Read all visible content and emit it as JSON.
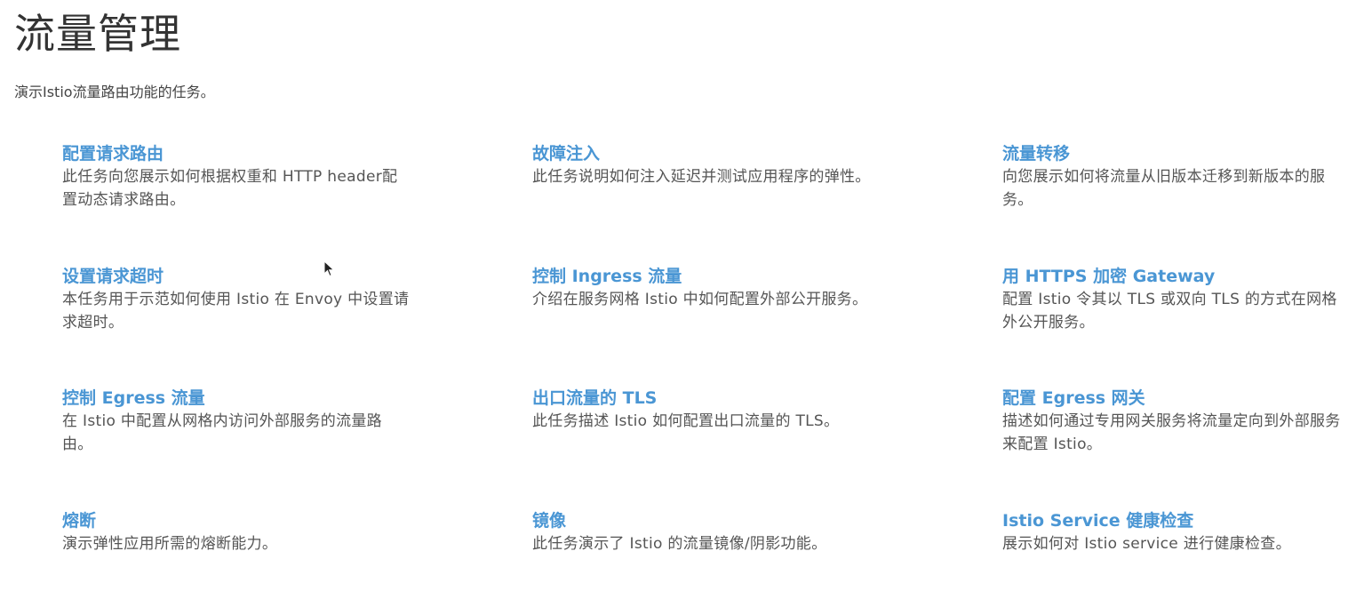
{
  "page": {
    "title": "流量管理",
    "subtitle": "演示Istio流量路由功能的任务。"
  },
  "colors": {
    "link": "#4a96d4",
    "text": "#555555",
    "title": "#333333"
  },
  "tasks": [
    {
      "title": "配置请求路由",
      "description": "此任务向您展示如何根据权重和 HTTP header配置动态请求路由。"
    },
    {
      "title": "故障注入",
      "description": "此任务说明如何注入延迟并测试应用程序的弹性。"
    },
    {
      "title": "流量转移",
      "description": "向您展示如何将流量从旧版本迁移到新版本的服务。"
    },
    {
      "title": "设置请求超时",
      "description": "本任务用于示范如何使用 Istio 在 Envoy 中设置请求超时。"
    },
    {
      "title": "控制 Ingress 流量",
      "description": "介绍在服务网格 Istio 中如何配置外部公开服务。"
    },
    {
      "title": "用 HTTPS 加密 Gateway",
      "description": "配置 Istio 令其以 TLS 或双向 TLS 的方式在网格外公开服务。"
    },
    {
      "title": "控制 Egress 流量",
      "description": "在 Istio 中配置从网格内访问外部服务的流量路由。"
    },
    {
      "title": "出口流量的 TLS",
      "description": "此任务描述 Istio 如何配置出口流量的 TLS。"
    },
    {
      "title": "配置 Egress 网关",
      "description": "描述如何通过专用网关服务将流量定向到外部服务来配置 Istio。"
    },
    {
      "title": "熔断",
      "description": "演示弹性应用所需的熔断能力。"
    },
    {
      "title": "镜像",
      "description": "此任务演示了 Istio 的流量镜像/阴影功能。"
    },
    {
      "title": "Istio Service 健康检查",
      "description": "展示如何对 Istio service 进行健康检查。"
    }
  ],
  "cursor": {
    "icon": "mouse-pointer-icon"
  }
}
